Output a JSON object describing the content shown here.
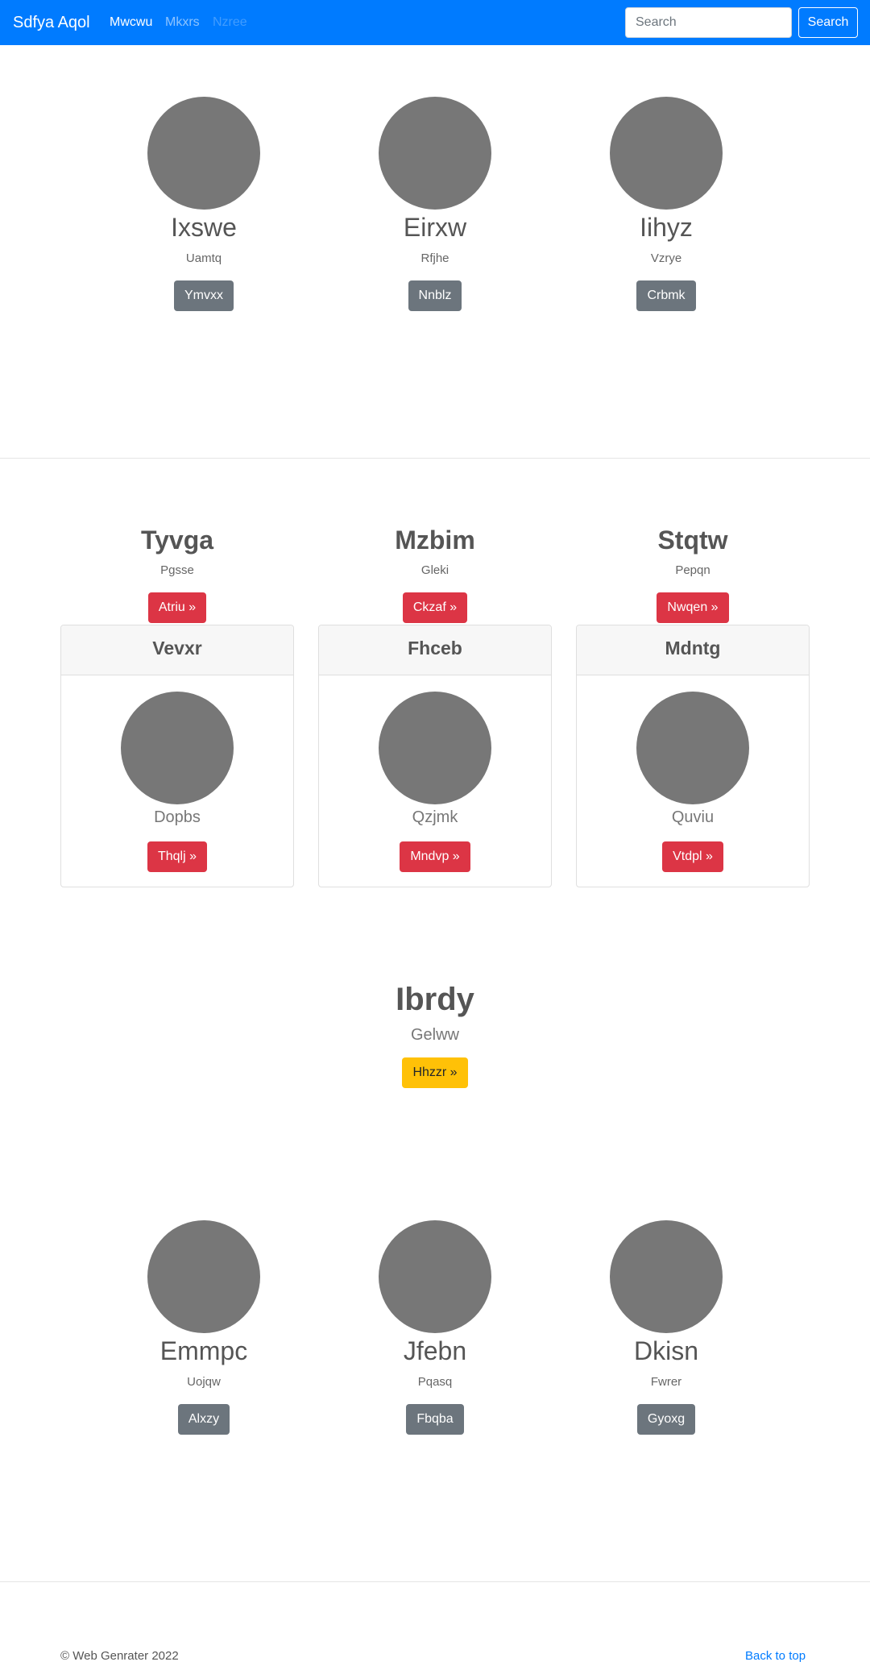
{
  "navbar": {
    "brand": "Sdfya Aqol",
    "links": [
      "Mwcwu",
      "Mkxrs",
      "Nzree"
    ],
    "search_placeholder": "Search",
    "search_button": "Search"
  },
  "row1": [
    {
      "name": "Ixswe",
      "subtitle": "Uamtq",
      "button": "Ymvxx"
    },
    {
      "name": "Eirxw",
      "subtitle": "Rfjhe",
      "button": "Nnblz"
    },
    {
      "name": "Iihyz",
      "subtitle": "Vzrye",
      "button": "Crbmk"
    }
  ],
  "heading_row": [
    {
      "title": "Tyvga",
      "subtitle": "Pgsse",
      "button": "Atriu »"
    },
    {
      "title": "Mzbim",
      "subtitle": "Gleki",
      "button": "Ckzaf »"
    },
    {
      "title": "Stqtw",
      "subtitle": "Pepqn",
      "button": "Nwqen »"
    }
  ],
  "cards": [
    {
      "header": "Vevxr",
      "subtitle": "Dopbs",
      "button": "Thqlj »"
    },
    {
      "header": "Fhceb",
      "subtitle": "Qzjmk",
      "button": "Mndvp »"
    },
    {
      "header": "Mdntg",
      "subtitle": "Quviu",
      "button": "Vtdpl »"
    }
  ],
  "feature": {
    "title": "Ibrdy",
    "subtitle": "Gelww",
    "button": "Hhzzr »"
  },
  "row2": [
    {
      "name": "Emmpc",
      "subtitle": "Uojqw",
      "button": "Alxzy"
    },
    {
      "name": "Jfebn",
      "subtitle": "Pqasq",
      "button": "Fbqba"
    },
    {
      "name": "Dkisn",
      "subtitle": "Fwrer",
      "button": "Gyoxg"
    }
  ],
  "footer": {
    "copyright": "© Web Genrater 2022",
    "back_to_top": "Back to top"
  },
  "colors": {
    "primary": "#007bff",
    "secondary": "#6c757d",
    "danger": "#dc3545",
    "warning": "#ffc107",
    "avatar": "#777777"
  }
}
